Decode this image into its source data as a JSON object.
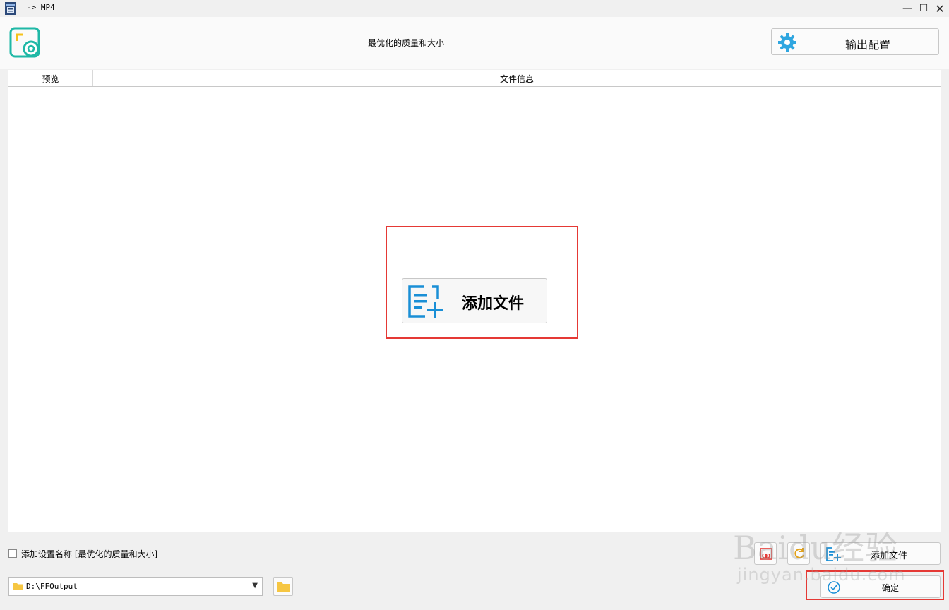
{
  "window": {
    "title": "-> MP4",
    "controls": {
      "minimize": "—",
      "maximize": "☐",
      "close": "✕"
    }
  },
  "header": {
    "profile_title": "最优化的质量和大小",
    "output_config_label": "输出配置"
  },
  "list": {
    "columns": [
      "预览",
      "文件信息"
    ],
    "add_file_label": "添加文件"
  },
  "bottom": {
    "add_setting_name_label": "添加设置名称 [最优化的质量和大小]",
    "add_setting_name_checked": false,
    "output_path": "D:\\FFOutput",
    "add_file_label": "添加文件",
    "ok_label": "确定"
  },
  "watermark": {
    "brand": "Baidu经验",
    "url": "jingyan.baidu.com"
  },
  "colors": {
    "accent_blue": "#1a8fd6",
    "logo_teal": "#1fb8a6",
    "logo_yellow": "#f5c21b",
    "highlight_red": "#e53935",
    "folder_yellow": "#f6c642"
  }
}
